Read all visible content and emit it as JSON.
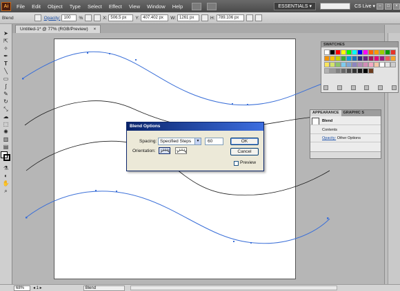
{
  "app": {
    "logo": "Ai"
  },
  "menu": {
    "items": [
      "File",
      "Edit",
      "Object",
      "Type",
      "Select",
      "Effect",
      "View",
      "Window",
      "Help"
    ],
    "workspace": "ESSENTIALS ▾",
    "cs_live": "CS Live ▾"
  },
  "controlbar": {
    "selection_label": "Blend",
    "opacity_label": "Opacity:",
    "opacity_value": "100",
    "opacity_unit": "%",
    "x_label": "X:",
    "x_value": "506.5 px",
    "y_label": "Y:",
    "y_value": "407.402 px",
    "w_label": "W:",
    "w_value": "1261 px",
    "h_label": "H:",
    "h_value": "789.106 px"
  },
  "document": {
    "tab_title": "Untitled-1* @ 77% (RGB/Preview)",
    "close": "×"
  },
  "swatches_panel": {
    "title": "SWATCHES",
    "colors": [
      "#ffffff",
      "#000000",
      "#ff0000",
      "#ffff00",
      "#00ff00",
      "#00ffff",
      "#0000ff",
      "#ff00ff",
      "#ff6600",
      "#ff9900",
      "#99cc00",
      "#009900",
      "#e6332a",
      "#f39200",
      "#fdc300",
      "#c7d300",
      "#3aa935",
      "#009ee0",
      "#1d71b8",
      "#2e2d7f",
      "#662483",
      "#a3195b",
      "#e4007c",
      "#951b81",
      "#ea5b5b",
      "#f6a52b",
      "#f9e55c",
      "#d3e46c",
      "#8ec66a",
      "#7ecbef",
      "#7fa8d7",
      "#8d84bf",
      "#b38ab9",
      "#d28db7",
      "#f4a8c2",
      "#f5c6a5",
      "#ffffff",
      "#e5e5e5",
      "#cccccc",
      "#b2b2b2",
      "#999999",
      "#808080",
      "#666666",
      "#4d4d4d",
      "#333333",
      "#1a1a1a",
      "#000000",
      "#6b3b1e"
    ]
  },
  "appearance_panel": {
    "tab_active": "APPEARANCE",
    "tab_other": "GRAPHIC S",
    "object_label": "Blend",
    "contents_label": "Contents",
    "opacity_label": "Opacity:",
    "opacity_value": "Other Options"
  },
  "blend_dialog": {
    "title": "Blend Options",
    "spacing_label": "Spacing:",
    "spacing_value": "Specified Steps",
    "steps_value": "60",
    "orientation_label": "Orientation:",
    "ok_label": "OK",
    "cancel_label": "Cancel",
    "preview_label": "Preview",
    "preview_checked": false
  },
  "statusbar": {
    "zoom": "68%",
    "nav": "◂ 1 ▸",
    "status": "Blend"
  },
  "colors": {
    "path_blue": "#3a6fd8",
    "path_black": "#1a1a1a",
    "dialog_title": "#0a246a"
  },
  "icons": [
    "ai-logo-icon",
    "selection-tool-icon",
    "direct-selection-tool-icon",
    "pen-tool-icon",
    "type-tool-icon",
    "line-tool-icon",
    "rectangle-tool-icon",
    "paintbrush-tool-icon",
    "pencil-tool-icon",
    "rotate-tool-icon",
    "scale-tool-icon",
    "warp-tool-icon",
    "free-transform-icon",
    "symbol-sprayer-icon",
    "graph-tool-icon",
    "gradient-tool-icon",
    "eyedropper-tool-icon",
    "blend-tool-icon",
    "hand-tool-icon",
    "zoom-tool-icon"
  ]
}
